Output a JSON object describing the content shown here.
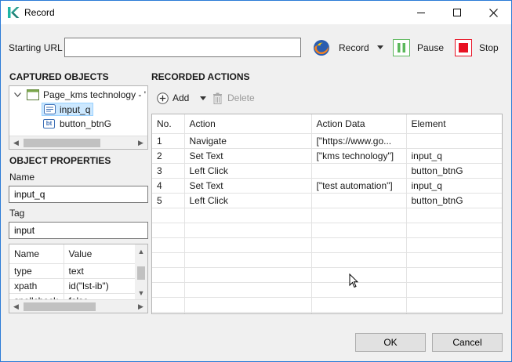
{
  "window": {
    "title": "Record"
  },
  "toolbar": {
    "starting_url_label": "Starting URL",
    "starting_url_value": "",
    "record_label": "Record",
    "pause_label": "Pause",
    "stop_label": "Stop"
  },
  "captured_objects": {
    "heading": "CAPTURED OBJECTS",
    "page_node": "Page_kms technology - '",
    "children": [
      {
        "badge": "",
        "label": "input_q"
      },
      {
        "badge": "bt",
        "label": "button_btnG"
      }
    ]
  },
  "object_properties": {
    "heading": "OBJECT PROPERTIES",
    "name_label": "Name",
    "name_value": "input_q",
    "tag_label": "Tag",
    "tag_value": "input",
    "columns": [
      "Name",
      "Value"
    ],
    "rows": [
      [
        "type",
        "text"
      ],
      [
        "xpath",
        "id(\"lst-ib\")"
      ],
      [
        "spellcheck",
        "false"
      ]
    ]
  },
  "recorded_actions": {
    "heading": "RECORDED ACTIONS",
    "add_label": "Add",
    "delete_label": "Delete",
    "columns": [
      "No.",
      "Action",
      "Action Data",
      "Element"
    ],
    "rows": [
      [
        "1",
        "Navigate",
        "[\"https://www.go...",
        ""
      ],
      [
        "2",
        "Set Text",
        "[\"kms technology\"]",
        "input_q"
      ],
      [
        "3",
        "Left Click",
        "",
        "button_btnG"
      ],
      [
        "4",
        "Set Text",
        "[\"test automation\"]",
        "input_q"
      ],
      [
        "5",
        "Left Click",
        "",
        "button_btnG"
      ]
    ]
  },
  "footer": {
    "ok_label": "OK",
    "cancel_label": "Cancel"
  },
  "colors": {
    "accent": "#2b7bd6",
    "selection": "#cce8ff",
    "pause_green": "#5cb85c",
    "stop_red": "#e81123"
  }
}
